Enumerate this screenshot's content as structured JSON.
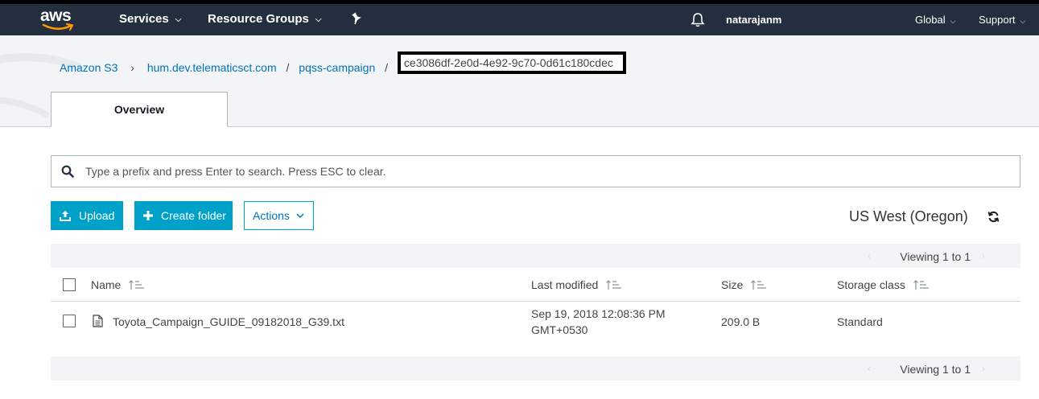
{
  "nav": {
    "logo_text": "aws",
    "services": "Services",
    "resource_groups": "Resource Groups",
    "pin_icon": "pushpin-icon",
    "bell_icon": "bell-icon",
    "user": "natarajanm",
    "global": "Global",
    "support": "Support"
  },
  "breadcrumb": {
    "items": [
      "Amazon S3",
      "hum.dev.telematicsct.com",
      "pqss-campaign"
    ],
    "current": "ce3086df-2e0d-4e92-9c70-0d61c180cdec"
  },
  "tabs": [
    {
      "label": "Overview",
      "active": true
    }
  ],
  "search": {
    "placeholder": "Type a prefix and press Enter to search. Press ESC to clear."
  },
  "toolbar": {
    "upload": "Upload",
    "create_folder": "Create folder",
    "actions": "Actions",
    "region": "US West (Oregon)"
  },
  "table": {
    "viewing_top": "Viewing 1 to 1",
    "viewing_bottom": "Viewing 1 to 1",
    "columns": [
      "Name",
      "Last modified",
      "Size",
      "Storage class"
    ],
    "rows": [
      {
        "name": "Toyota_Campaign_GUIDE_09182018_G39.txt",
        "last_modified_line1": "Sep 19, 2018 12:08:36 PM",
        "last_modified_line2": "GMT+0530",
        "size": "209.0 B",
        "storage_class": "Standard"
      }
    ]
  },
  "colors": {
    "nav_bg": "#232f3e",
    "accent": "#00a1c9",
    "link": "#0073bb",
    "band_bg": "#f2f4f5"
  }
}
